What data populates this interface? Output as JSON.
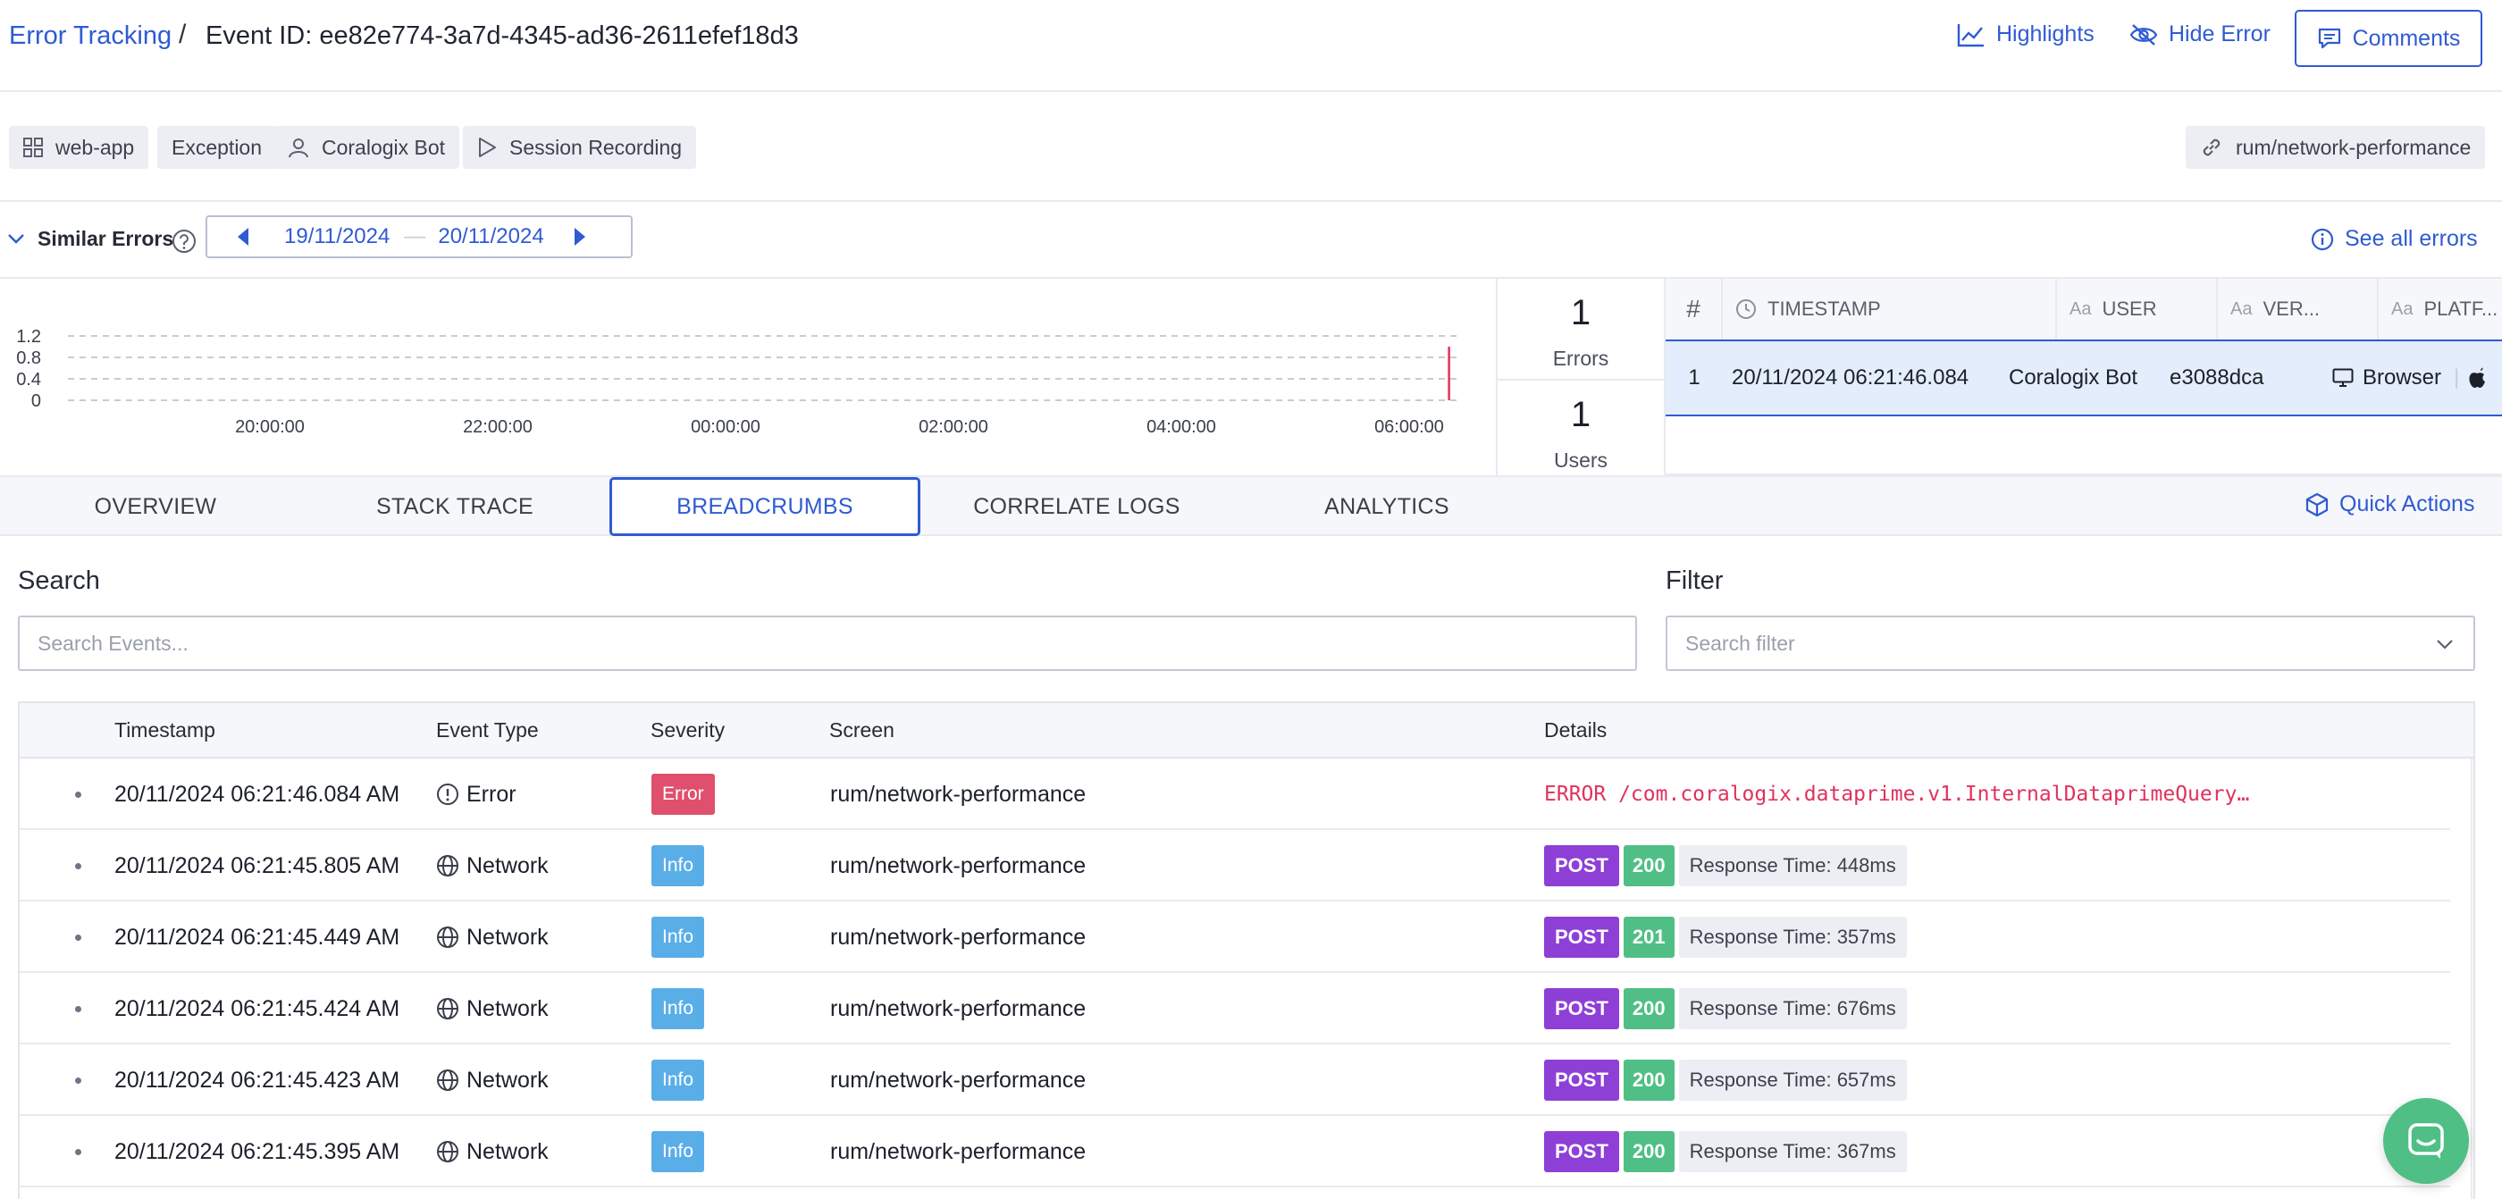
{
  "header": {
    "breadcrumb_link": "Error Tracking",
    "breadcrumb_separator": "/",
    "title": "Event ID: ee82e774-3a7d-4345-ad36-2611efef18d3",
    "highlights": "Highlights",
    "hide_error": "Hide Error",
    "comments": "Comments"
  },
  "tags": {
    "app": "web-app",
    "type": "Exception",
    "user": "Coralogix Bot",
    "session": "Session Recording",
    "page": "rum/network-performance"
  },
  "similar": {
    "label": "Similar Errors",
    "date_from": "19/11/2024",
    "date_sep": "—",
    "date_to": "20/11/2024",
    "see_all": "See all errors"
  },
  "chart_data": {
    "type": "line",
    "title": "",
    "xlabel": "",
    "ylabel": "",
    "ylim": [
      0,
      1.2
    ],
    "y_ticks": [
      "1.2",
      "0.8",
      "0.4",
      "0"
    ],
    "x_ticks": [
      "20:00:00",
      "22:00:00",
      "00:00:00",
      "02:00:00",
      "04:00:00",
      "06:00:00"
    ],
    "series": [
      {
        "x": [
          "20/11/2024 06:21"
        ],
        "values": [
          1
        ]
      }
    ],
    "grid": true,
    "colors": {
      "grid": "#c8ccd4",
      "mark": "#e0325c"
    }
  },
  "stats": {
    "errors_count": "1",
    "errors_label": "Errors",
    "users_count": "1",
    "users_label": "Users"
  },
  "error_table": {
    "headers": {
      "num": "#",
      "timestamp": "TIMESTAMP",
      "user": "USER",
      "version": "VER...",
      "platform": "PLATF..."
    },
    "type_prefix": "Aa",
    "row": {
      "num": "1",
      "timestamp": "20/11/2024 06:21:46.084",
      "user": "Coralogix Bot",
      "version": "e3088dca",
      "platform": "Browser"
    }
  },
  "tabs": [
    "OVERVIEW",
    "STACK TRACE",
    "BREADCRUMBS",
    "CORRELATE LOGS",
    "ANALYTICS"
  ],
  "active_tab": "BREADCRUMBS",
  "quick_actions": "Quick Actions",
  "filters": {
    "search_label": "Search",
    "search_placeholder": "Search Events...",
    "filter_label": "Filter",
    "filter_placeholder": "Search filter"
  },
  "breadcrumbs": {
    "headers": [
      "Timestamp",
      "Event Type",
      "Severity",
      "Screen",
      "Details"
    ],
    "rows": [
      {
        "timestamp": "20/11/2024 06:21:46.084 AM",
        "event_type": "Error",
        "icon": "alert-circle-icon",
        "severity": "Error",
        "severity_color": "#e04f6e",
        "screen": "rum/network-performance",
        "details": "ERROR /com.coralogix.dataprime.v1.InternalDataprimeQuery…"
      },
      {
        "timestamp": "20/11/2024 06:21:45.805 AM",
        "event_type": "Network",
        "icon": "globe-icon",
        "severity": "Info",
        "severity_color": "#5aaee8",
        "screen": "rum/network-performance",
        "method": "POST",
        "status": "200",
        "response": "Response Time: 448ms"
      },
      {
        "timestamp": "20/11/2024 06:21:45.449 AM",
        "event_type": "Network",
        "icon": "globe-icon",
        "severity": "Info",
        "severity_color": "#5aaee8",
        "screen": "rum/network-performance",
        "method": "POST",
        "status": "201",
        "response": "Response Time: 357ms"
      },
      {
        "timestamp": "20/11/2024 06:21:45.424 AM",
        "event_type": "Network",
        "icon": "globe-icon",
        "severity": "Info",
        "severity_color": "#5aaee8",
        "screen": "rum/network-performance",
        "method": "POST",
        "status": "200",
        "response": "Response Time: 676ms"
      },
      {
        "timestamp": "20/11/2024 06:21:45.423 AM",
        "event_type": "Network",
        "icon": "globe-icon",
        "severity": "Info",
        "severity_color": "#5aaee8",
        "screen": "rum/network-performance",
        "method": "POST",
        "status": "200",
        "response": "Response Time: 657ms"
      },
      {
        "timestamp": "20/11/2024 06:21:45.395 AM",
        "event_type": "Network",
        "icon": "globe-icon",
        "severity": "Info",
        "severity_color": "#5aaee8",
        "screen": "rum/network-performance",
        "method": "POST",
        "status": "200",
        "response": "Response Time: 367ms"
      }
    ]
  }
}
